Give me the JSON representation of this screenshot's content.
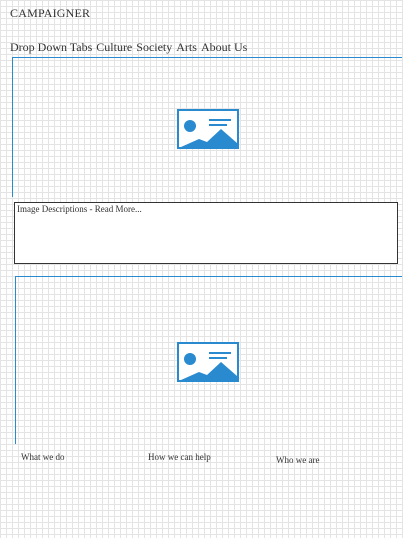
{
  "brand": "CAMPAIGNER",
  "nav": [
    "Drop Down Tabs",
    "Culture",
    "Society",
    "Arts",
    "About Us"
  ],
  "hero1": {
    "icon": "image-placeholder-icon"
  },
  "description": {
    "text": "Image Descriptions - Read More..."
  },
  "hero2": {
    "icon": "image-placeholder-icon"
  },
  "footer_links": [
    "What we do",
    "How we can help",
    "Who we are"
  ],
  "colors": {
    "accent": "#2a8ad0",
    "icon": "#2a8ad0",
    "text": "#333333",
    "grid": "#e4e4e4"
  }
}
